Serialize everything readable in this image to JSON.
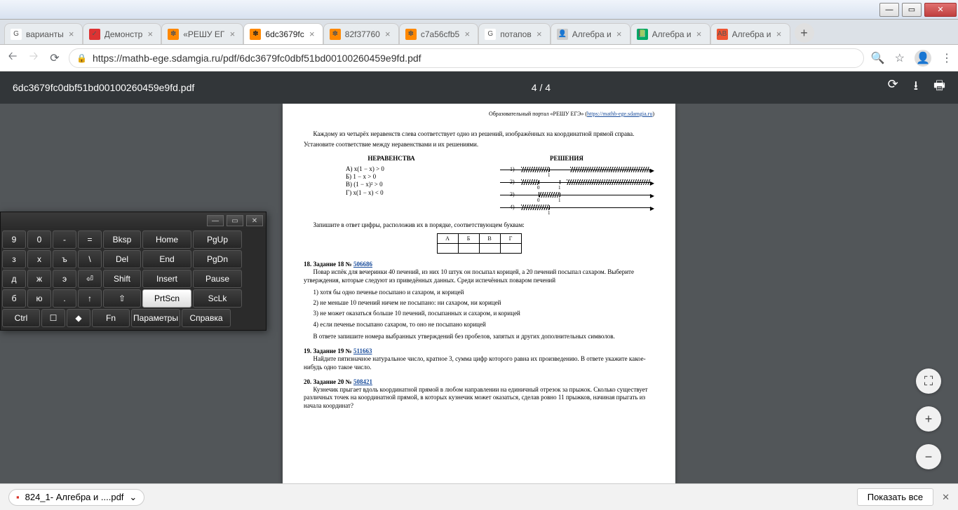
{
  "tabs": [
    {
      "label": "варианты",
      "favicon_bg": "#fff",
      "favicon_text": "G"
    },
    {
      "label": "Демонстр",
      "favicon_bg": "#d33",
      "favicon_text": "✓"
    },
    {
      "label": "«РЕШУ ЕГ",
      "favicon_bg": "#f80",
      "favicon_text": "✽"
    },
    {
      "label": "6dc3679fc",
      "favicon_bg": "#f80",
      "favicon_text": "✽",
      "active": true
    },
    {
      "label": "82f37760",
      "favicon_bg": "#f80",
      "favicon_text": "✽"
    },
    {
      "label": "c7a56cfb5",
      "favicon_bg": "#f80",
      "favicon_text": "✽"
    },
    {
      "label": "потапов",
      "favicon_bg": "#fff",
      "favicon_text": "G"
    },
    {
      "label": "Алгебра и",
      "favicon_bg": "#ccc",
      "favicon_text": "👤"
    },
    {
      "label": "Алгебра и",
      "favicon_bg": "#0a6",
      "favicon_text": "📗"
    },
    {
      "label": "Алгебра и",
      "favicon_bg": "#e53",
      "favicon_text": "АВ"
    }
  ],
  "url": "https://mathb-ege.sdamgia.ru/pdf/6dc3679fc0dbf51bd00100260459e9fd.pdf",
  "pdf": {
    "filename": "6dc3679fc0dbf51bd00100260459e9fd.pdf",
    "page_indicator": "4 / 4",
    "portal_prefix": "Образовательный портал «РЕШУ ЕГЭ» (",
    "portal_link": "https://mathb-ege.sdamgia.ru",
    "portal_suffix": ")",
    "intro1": "Каждому из четырёх неравенств слева соответствует одно из решений, изображённых на координатной прямой справа.",
    "intro2": "Установите соответствие между неравенствами и их решениями.",
    "left_title": "НЕРАВЕНСТВА",
    "right_title": "РЕШЕНИЯ",
    "ineq_a": "А) x(1 − x) > 0",
    "ineq_b": "Б) 1 − x > 0",
    "ineq_c": "В) (1 − x)² > 0",
    "ineq_d": "Г) x(1 − x) < 0",
    "row1": "1)",
    "row2": "2)",
    "row3": "3)",
    "row4": "4)",
    "tick0": "0",
    "tick1": "1",
    "answer_prompt": "Запишите в ответ цифры, расположив их в порядке, соответствующем буквам:",
    "hdrA": "А",
    "hdrB": "Б",
    "hdrV": "В",
    "hdrG": "Г",
    "t18_head": "18. Задание 18 № ",
    "t18_link": "506686",
    "t18_body": "Повар испёк для вечеринки 40 печений, из них 10 штук он посыпал корицей, а 20 печений посыпал сахаром. Выберите утверждения, которые следуют из приведённых данных. Среди испечённых поваром печений",
    "t18_1": "1) хотя бы одно печенье посыпано и сахаром, и корицей",
    "t18_2": "2) не меньше 10 печений ничем не посыпано: ни сахаром, ни корицей",
    "t18_3": "3) не может оказаться больше 10 печений, посыпанных и сахаром, и корицей",
    "t18_4": "4) если печенье посыпано сахаром, то оно не посыпано корицей",
    "t18_note": "В ответе запишите номера выбранных утверждений без пробелов, запятых и других дополнительных символов.",
    "t19_head": "19. Задание 19 № ",
    "t19_link": "511663",
    "t19_body": "Найдите пятизначное натуральное число, кратное 3, сумма цифр которого равна их произведению. В ответе укажите какое-нибудь одно такое число.",
    "t20_head": "20. Задание 20 № ",
    "t20_link": "508421",
    "t20_body": "Кузнечик прыгает вдоль координатной прямой в любом направлении на единичный отрезок за прыжок. Сколько существует различных точек на координатной прямой, в которых кузнечик может оказаться, сделав ровно 11 прыжков, начиная прыгать из начала координат?"
  },
  "download": {
    "file": "824_1- Алгебра и ....pdf",
    "show_all": "Показать все"
  },
  "osk": {
    "r1": [
      "9",
      "0",
      "-",
      "=",
      "Bksp",
      "Home",
      "PgUp"
    ],
    "r2": [
      "з",
      "х",
      "ъ",
      "\\",
      "Del",
      "End",
      "PgDn"
    ],
    "r3": [
      "д",
      "ж",
      "э",
      "⏎",
      "Shift",
      "Insert",
      "Pause"
    ],
    "r4": [
      "б",
      "ю",
      ".",
      "↑",
      "⇧",
      "PrtScn",
      "ScLk"
    ],
    "r5": [
      "Ctrl",
      "☐",
      "◆",
      "Fn",
      "Параметры",
      "Справка"
    ]
  }
}
